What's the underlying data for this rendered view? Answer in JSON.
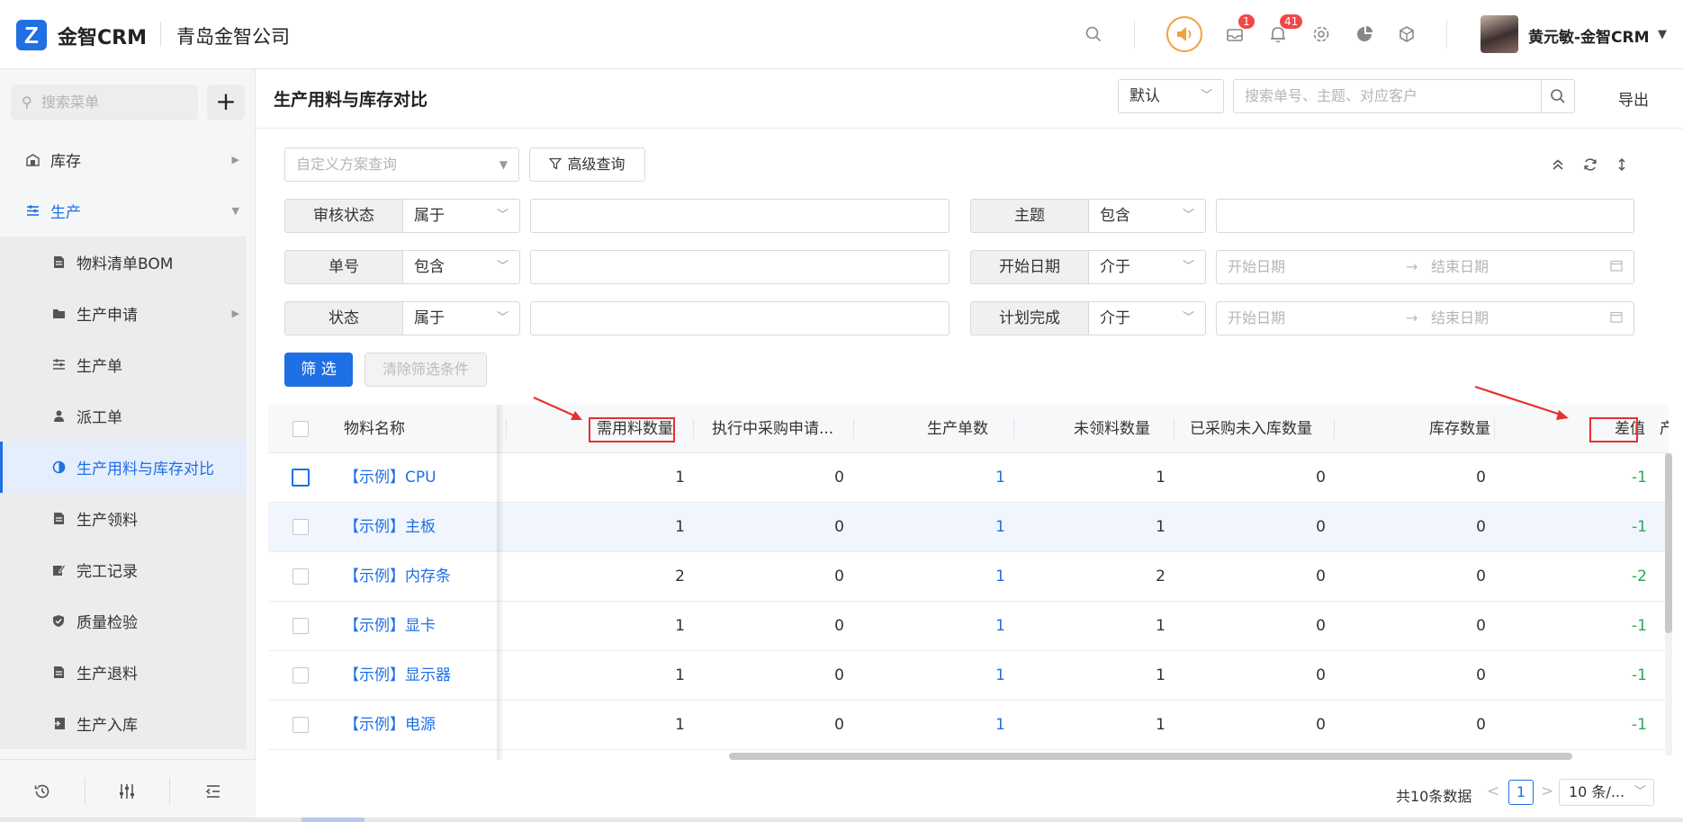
{
  "header": {
    "logo_letter": "Z",
    "brand": "金智CRM",
    "company": "青岛金智公司",
    "mail_badge": "1",
    "bell_badge": "41",
    "username": "黄元敏-金智CRM"
  },
  "sidebar": {
    "search_placeholder": "搜索菜单",
    "add_label": "+",
    "items": [
      {
        "label": "库存",
        "icon": "warehouse-icon"
      },
      {
        "label": "生产",
        "icon": "production-icon"
      },
      {
        "label": "物料清单BOM",
        "icon": "doc-icon"
      },
      {
        "label": "生产申请",
        "icon": "folder-icon"
      },
      {
        "label": "生产单",
        "icon": "list-icon"
      },
      {
        "label": "派工单",
        "icon": "worker-icon"
      },
      {
        "label": "生产用料与库存对比",
        "icon": "contrast-icon"
      },
      {
        "label": "生产领料",
        "icon": "doc-icon"
      },
      {
        "label": "完工记录",
        "icon": "edit-icon"
      },
      {
        "label": "质量检验",
        "icon": "shield-icon"
      },
      {
        "label": "生产退料",
        "icon": "doc-icon"
      },
      {
        "label": "生产入库",
        "icon": "inbound-icon"
      }
    ]
  },
  "toolbar": {
    "page_title": "生产用料与库存对比",
    "mode_value": "默认",
    "search_placeholder": "搜索单号、主题、对应客户",
    "export_label": "导出"
  },
  "filters": {
    "scheme_placeholder": "自定义方案查询",
    "advanced_label": "高级查询",
    "rows": [
      {
        "label": "审核状态",
        "op": "属于"
      },
      {
        "label": "单号",
        "op": "包含"
      },
      {
        "label": "状态",
        "op": "属于"
      },
      {
        "label": "主题",
        "op": "包含"
      },
      {
        "label": "开始日期",
        "op": "介于"
      },
      {
        "label": "计划完成",
        "op": "介于"
      }
    ],
    "date_start_placeholder": "开始日期",
    "date_end_placeholder": "结束日期",
    "arrow": "→",
    "filter_btn": "筛 选",
    "clear_btn": "清除筛选条件"
  },
  "table": {
    "columns": [
      "物料名称",
      "需用料数量",
      "执行中采购申请...",
      "生产单数",
      "未领料数量",
      "已采购未入库数量",
      "库存数量",
      "差值",
      "产"
    ],
    "rows": [
      {
        "name": "【示例】CPU",
        "need": "1",
        "purchasing": "0",
        "orders": "1",
        "unpicked": "1",
        "not_in": "0",
        "stock": "0",
        "diff": "-1"
      },
      {
        "name": "【示例】主板",
        "need": "1",
        "purchasing": "0",
        "orders": "1",
        "unpicked": "1",
        "not_in": "0",
        "stock": "0",
        "diff": "-1"
      },
      {
        "name": "【示例】内存条",
        "need": "2",
        "purchasing": "0",
        "orders": "1",
        "unpicked": "2",
        "not_in": "0",
        "stock": "0",
        "diff": "-2"
      },
      {
        "name": "【示例】显卡",
        "need": "1",
        "purchasing": "0",
        "orders": "1",
        "unpicked": "1",
        "not_in": "0",
        "stock": "0",
        "diff": "-1"
      },
      {
        "name": "【示例】显示器",
        "need": "1",
        "purchasing": "0",
        "orders": "1",
        "unpicked": "1",
        "not_in": "0",
        "stock": "0",
        "diff": "-1"
      },
      {
        "name": "【示例】电源",
        "need": "1",
        "purchasing": "0",
        "orders": "1",
        "unpicked": "1",
        "not_in": "0",
        "stock": "0",
        "diff": "-1"
      }
    ]
  },
  "pagination": {
    "total_text": "共10条数据",
    "prev": "<",
    "current": "1",
    "next": ">",
    "page_size": "10 条/..."
  },
  "colors": {
    "accent": "#1f6fe5",
    "diff_negative": "#29a858",
    "annotation_red": "#e53131",
    "speaker_orange": "#f3a13a"
  }
}
